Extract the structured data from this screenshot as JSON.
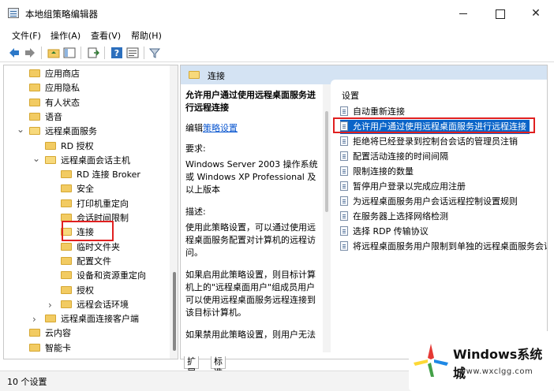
{
  "window": {
    "title": "本地组策略编辑器"
  },
  "menu": [
    "文件(F)",
    "操作(A)",
    "查看(V)",
    "帮助(H)"
  ],
  "tree": [
    {
      "label": "应用商店",
      "indent": 1
    },
    {
      "label": "应用隐私",
      "indent": 1
    },
    {
      "label": "有人状态",
      "indent": 1
    },
    {
      "label": "语音",
      "indent": 1
    },
    {
      "label": "远程桌面服务",
      "indent": 1,
      "expanded": true
    },
    {
      "label": "RD 授权",
      "indent": 2
    },
    {
      "label": "远程桌面会话主机",
      "indent": 2,
      "expanded": true
    },
    {
      "label": "RD 连接 Broker",
      "indent": 3
    },
    {
      "label": "安全",
      "indent": 3
    },
    {
      "label": "打印机重定向",
      "indent": 3
    },
    {
      "label": "会话时间限制",
      "indent": 3
    },
    {
      "label": "连接",
      "indent": 3,
      "selected": true
    },
    {
      "label": "临时文件夹",
      "indent": 3
    },
    {
      "label": "配置文件",
      "indent": 3
    },
    {
      "label": "设备和资源重定向",
      "indent": 3
    },
    {
      "label": "授权",
      "indent": 3
    },
    {
      "label": "远程会话环境",
      "indent": 3,
      "collapsed": true
    },
    {
      "label": "远程桌面连接客户端",
      "indent": 2,
      "collapsed": true
    },
    {
      "label": "云内容",
      "indent": 1
    },
    {
      "label": "智能卡",
      "indent": 1
    }
  ],
  "right_pane": {
    "header": "连接",
    "policy_title": "允许用户通过使用远程桌面服务进行远程连接",
    "edit_prefix": "编辑",
    "edit_link": "策略设置",
    "requirements_label": "要求:",
    "requirements_text": "Windows Server 2003 操作系统或 Windows XP Professional 及以上版本",
    "description_label": "描述:",
    "description_text": "使用此策略设置，可以通过使用远程桌面服务配置对计算机的远程访问。",
    "enabled_text": "如果启用此策略设置，则目标计算机上的\"远程桌面用户\"组成员用户可以使用远程桌面服务远程连接到该目标计算机。",
    "disabled_text": "如果禁用此策略设置，则用户无法"
  },
  "settings": {
    "header": "设置",
    "items": [
      "自动重新连接",
      "允许用户通过使用远程桌面服务进行远程连接",
      "拒绝将已经登录到控制台会话的管理员注销",
      "配置活动连接的时间间隔",
      "限制连接的数量",
      "暂停用户登录以完成应用注册",
      "为远程桌面服务用户会话远程控制设置规则",
      "在服务器上选择网络检测",
      "选择 RDP 传输协议",
      "将远程桌面服务用户限制到单独的远程桌面服务会话"
    ],
    "selected_index": 1
  },
  "tabs": [
    "扩展",
    "标准"
  ],
  "status": "10 个设置",
  "watermark": {
    "brand": "Windows系统城",
    "url": "www.wxclgg.com"
  }
}
